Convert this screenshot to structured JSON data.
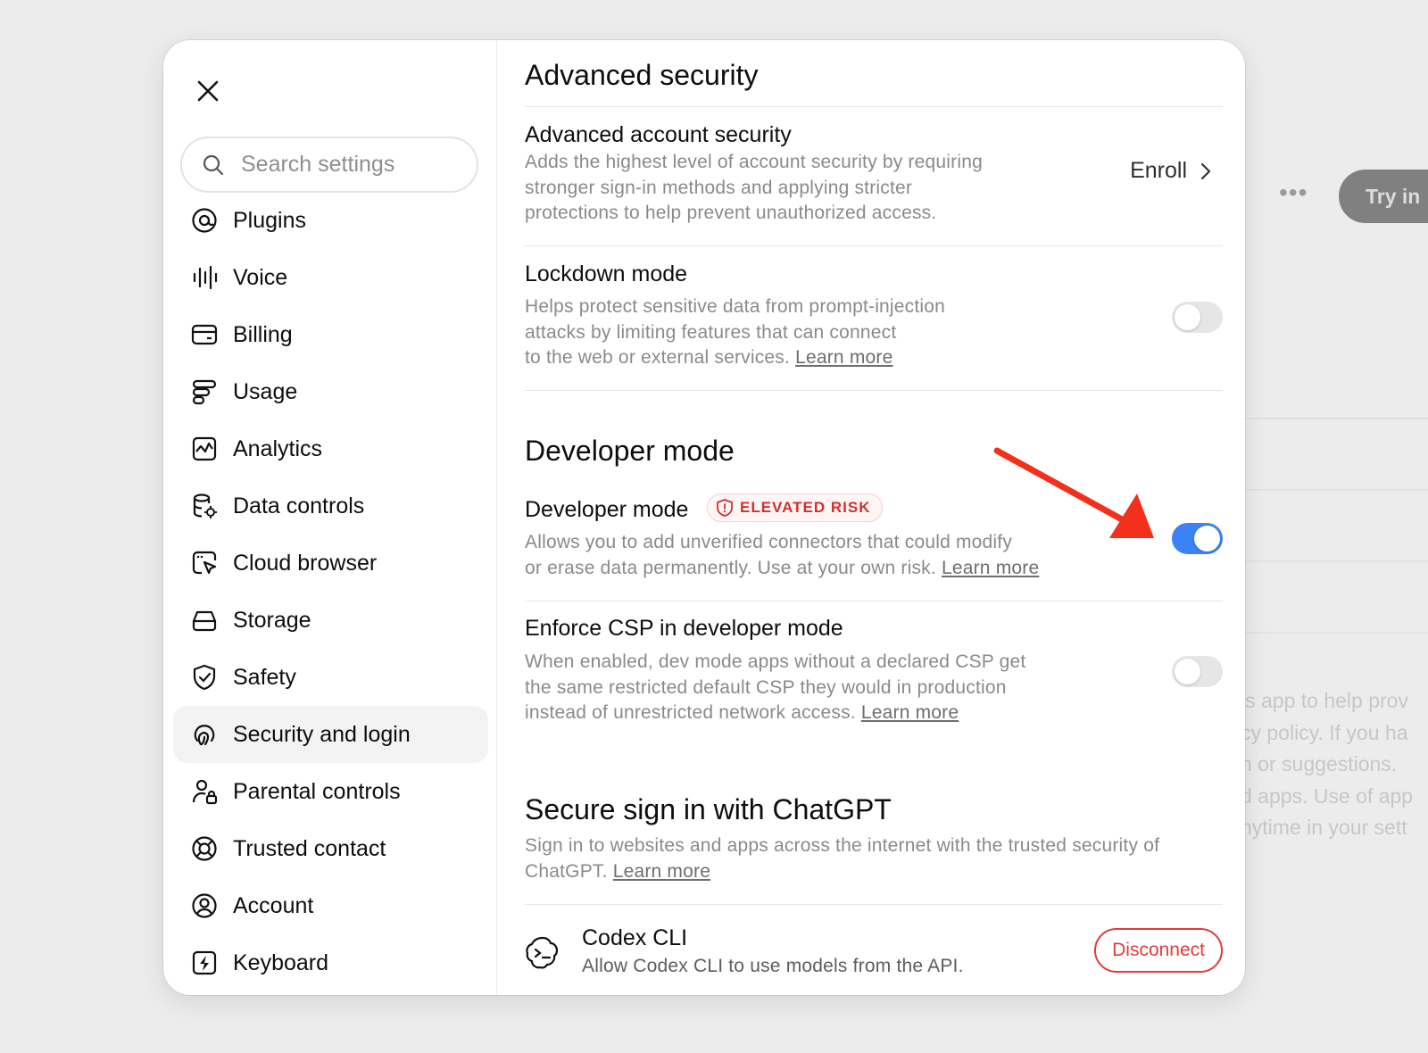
{
  "background": {
    "overflow_button": "•••",
    "try_button": "Try in",
    "text_lines": [
      "is app to help prov",
      "cy policy. If you ha",
      "n or suggestions.",
      "d apps. Use of app",
      "nytime in your sett"
    ]
  },
  "sidebar": {
    "search_placeholder": "Search settings",
    "items": [
      {
        "label": "Plugins",
        "icon": "plugins-icon"
      },
      {
        "label": "Voice",
        "icon": "voice-waveform-icon"
      },
      {
        "label": "Billing",
        "icon": "credit-card-icon"
      },
      {
        "label": "Usage",
        "icon": "usage-bars-icon"
      },
      {
        "label": "Analytics",
        "icon": "analytics-chart-icon"
      },
      {
        "label": "Data controls",
        "icon": "database-gear-icon"
      },
      {
        "label": "Cloud browser",
        "icon": "browser-cursor-icon"
      },
      {
        "label": "Storage",
        "icon": "storage-drive-icon"
      },
      {
        "label": "Safety",
        "icon": "shield-check-icon"
      },
      {
        "label": "Security and login",
        "icon": "fingerprint-icon"
      },
      {
        "label": "Parental controls",
        "icon": "person-lock-icon"
      },
      {
        "label": "Trusted contact",
        "icon": "lifebuoy-icon"
      },
      {
        "label": "Account",
        "icon": "user-circle-icon"
      },
      {
        "label": "Keyboard",
        "icon": "keyboard-bolt-icon"
      }
    ],
    "active_item": "Security and login"
  },
  "content": {
    "advanced": {
      "heading": "Advanced security",
      "account_security_title": "Advanced account security",
      "account_security_desc": [
        "Adds the highest level of account security by requiring",
        "stronger sign-in methods and applying stricter",
        "protections to help prevent unauthorized access."
      ],
      "enroll_label": "Enroll",
      "lockdown_title": "Lockdown mode",
      "lockdown_desc": [
        "Helps protect sensitive data from prompt-injection",
        "attacks by limiting features that can connect",
        "to the web or external services."
      ],
      "lockdown_link": "Learn more",
      "lockdown_enabled": false
    },
    "developer": {
      "heading": "Developer mode",
      "title": "Developer mode",
      "badge": "ELEVATED RISK",
      "desc": [
        "Allows you to add unverified connectors that could modify",
        "or erase data permanently. Use at your own risk."
      ],
      "link": "Learn more",
      "enabled": true,
      "csp_title": "Enforce CSP in developer mode",
      "csp_desc": [
        "When enabled, dev mode apps without a declared CSP get",
        "the same restricted default CSP they would in production",
        "instead of unrestricted network access."
      ],
      "csp_link": "Learn more",
      "csp_enabled": false
    },
    "secure_sign_in": {
      "heading": "Secure sign in with ChatGPT",
      "desc": [
        "Sign in to websites and apps across the internet with the trusted security of",
        "ChatGPT."
      ],
      "link": "Learn more",
      "app_name": "Codex CLI",
      "app_desc": "Allow Codex CLI to use models from the API.",
      "disconnect_label": "Disconnect"
    }
  },
  "colors": {
    "toggle_on": "#3b82f6",
    "risk_red": "#d0302f",
    "annotation_arrow": "#f2301b"
  }
}
